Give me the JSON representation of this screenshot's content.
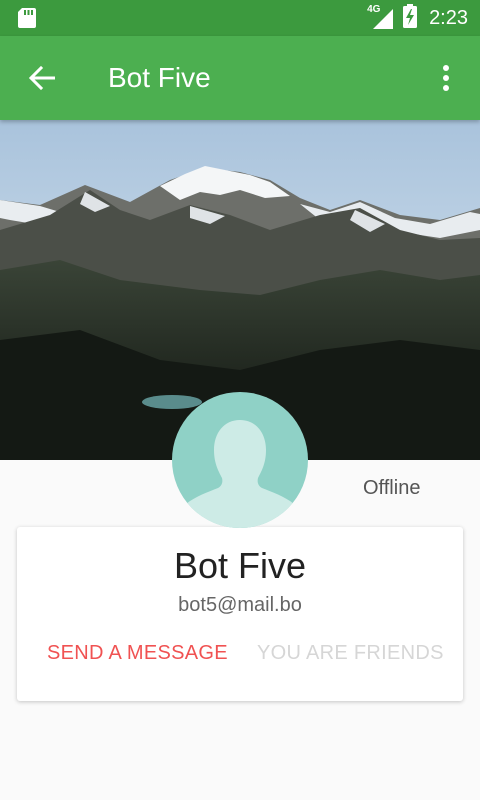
{
  "status_bar": {
    "network": "4G",
    "time": "2:23"
  },
  "app_bar": {
    "title": "Bot Five"
  },
  "profile": {
    "presence": "Offline",
    "name": "Bot Five",
    "email": "bot5@mail.bo"
  },
  "actions": {
    "send_message": "SEND A MESSAGE",
    "friends_status": "YOU ARE FRIENDS"
  },
  "colors": {
    "status_bar": "#3c9a3e",
    "app_bar": "#4caf50",
    "accent": "#f05252",
    "avatar": "#8fd1c6"
  },
  "icons": {
    "back": "arrow-left-icon",
    "more": "more-vertical-icon",
    "sd_card": "sd-card-icon",
    "signal": "signal-icon",
    "battery": "battery-charging-icon"
  }
}
